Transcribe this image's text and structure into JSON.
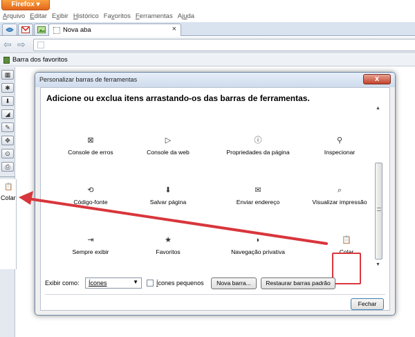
{
  "firefox_button": {
    "label": "Firefox"
  },
  "menubar": {
    "items": [
      {
        "pre": "",
        "u": "A",
        "post": "rquivo"
      },
      {
        "pre": "",
        "u": "E",
        "post": "ditar"
      },
      {
        "pre": "E",
        "u": "x",
        "post": "ibir"
      },
      {
        "pre": "",
        "u": "H",
        "post": "istórico"
      },
      {
        "pre": "Fa",
        "u": "v",
        "post": "oritos"
      },
      {
        "pre": "",
        "u": "F",
        "post": "erramentas"
      },
      {
        "pre": "Aj",
        "u": "u",
        "post": "da"
      }
    ]
  },
  "tabs": {
    "active_label": "Nova aba",
    "close_glyph": "×"
  },
  "navbar": {
    "back_glyph": "⇦",
    "forward_glyph": "⇨"
  },
  "bookmarks_toolbar": {
    "label": "Barra dos favoritos"
  },
  "left_toolbar": {
    "buttons": [
      "▦",
      "✱",
      "⬇",
      "◢",
      "✎",
      "✥",
      "⊙",
      "⎙"
    ],
    "colar_icon": "📋",
    "colar_label": "Colar"
  },
  "dialog": {
    "title": "Personalizar barras de ferramentas",
    "close_glyph": "x",
    "heading": "Adicione ou exclua itens arrastando-os das barras de ferramentas.",
    "palette": [
      {
        "icon": "⊠",
        "label": "Console de erros"
      },
      {
        "icon": "▷",
        "label": "Console da web"
      },
      {
        "icon": "ⓘ",
        "label": "Propriedades da página"
      },
      {
        "icon": "⚲",
        "label": "Inspecionar"
      },
      {
        "icon": "⟲",
        "label": "Código-fonte"
      },
      {
        "icon": "⬇",
        "label": "Salvar página"
      },
      {
        "icon": "✉",
        "label": "Enviar endereço"
      },
      {
        "icon": "⌕",
        "label": "Visualizar impressão"
      },
      {
        "icon": "⇥",
        "label": "Sempre exibir"
      },
      {
        "icon": "★",
        "label": "Favoritos"
      },
      {
        "icon": "◗",
        "label": "Navegação privativa"
      },
      {
        "icon": "📋",
        "label": "Colar"
      }
    ],
    "show_as_label": "Exibir como:",
    "show_as_value": "Ícones",
    "small_icons": {
      "pre": "",
      "u": "Í",
      "post": "cones pequenos"
    },
    "new_toolbar_button": "Nova barra...",
    "restore_button": "Restaurar barras padrão",
    "close_button": "Fechar"
  },
  "annotation": {
    "arrow_color": "#d8363c"
  }
}
